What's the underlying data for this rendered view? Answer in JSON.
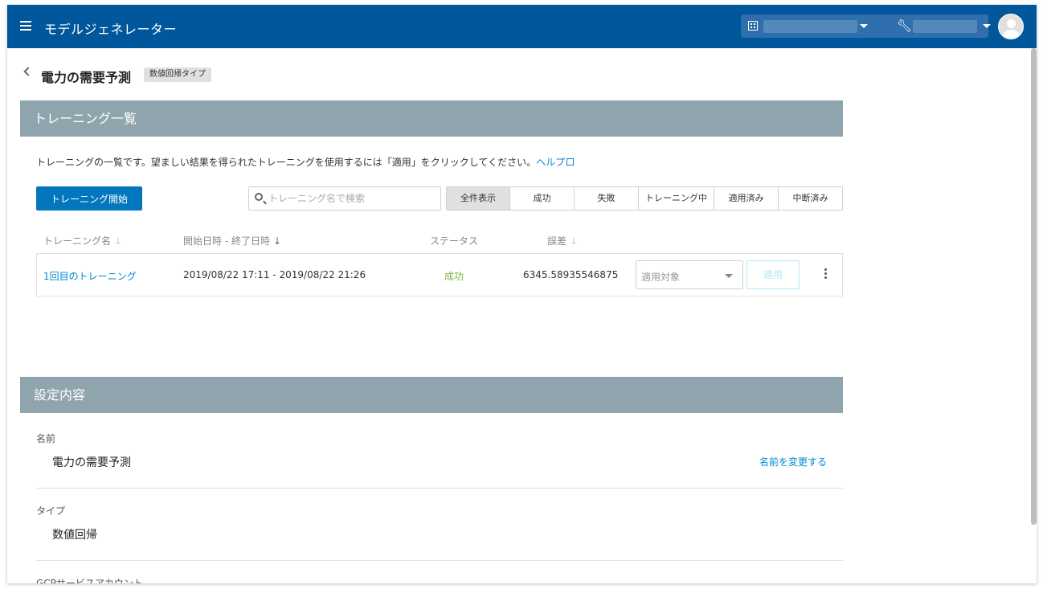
{
  "header": {
    "app_title": "モデルジェネレーター",
    "org_name": "",
    "project_name": ""
  },
  "page": {
    "title": "電力の需要予測",
    "type_badge": "数値回帰タイプ"
  },
  "training_section": {
    "title": "トレーニング一覧",
    "description": "トレーニングの一覧です。望ましい結果を得られたトレーニングを使用するには「適用」をクリックしてください。",
    "help_link": "ヘルプ",
    "start_button": "トレーニング開始",
    "search_placeholder": "トレーニング名で検索",
    "filters": [
      "全件表示",
      "成功",
      "失敗",
      "トレーニング中",
      "適用済み",
      "中断済み"
    ],
    "active_filter": "全件表示",
    "columns": {
      "name": "トレーニング名",
      "datetime": "開始日時 - 終了日時",
      "status": "ステータス",
      "error": "誤差"
    },
    "rows": [
      {
        "name": "1回目のトレーニング",
        "datetime": "2019/08/22 17:11 - 2019/08/22 21:26",
        "status": "成功",
        "error": "6345.58935546875",
        "apply_select_placeholder": "適用対象",
        "apply_button": "適用"
      }
    ]
  },
  "settings_section": {
    "title": "設定内容",
    "name_label": "名前",
    "name_value": "電力の需要予測",
    "rename_link": "名前を変更する",
    "type_label": "タイプ",
    "type_value": "数値回帰",
    "gcp_label": "GCPサービスアカウント"
  },
  "colors": {
    "topbar": "#01579b",
    "section_header": "#90a4ae",
    "primary_button": "#0277bd",
    "link": "#0288d1",
    "success": "#7cb342"
  }
}
